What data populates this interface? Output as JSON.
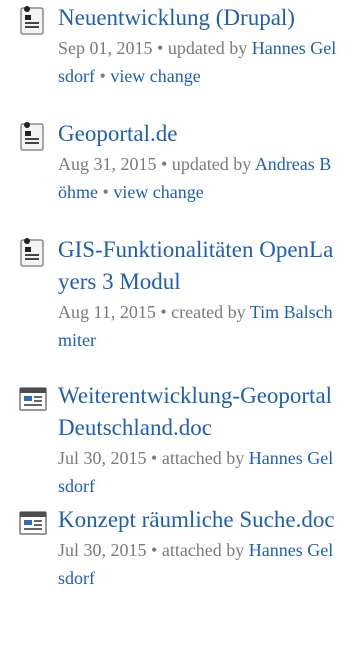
{
  "activity": {
    "items": [
      {
        "icon": "page-icon",
        "title": "Neuentwicklung (Drupal)",
        "date": "Sep 01, 2015",
        "action": "updated by",
        "author": "Hannes Gelsdorf",
        "extra_link": "view change"
      },
      {
        "icon": "page-icon",
        "title": "Geoportal.de",
        "date": "Aug 31, 2015",
        "action": "updated by",
        "author": "Andreas Böhme",
        "extra_link": "view change"
      },
      {
        "icon": "page-icon",
        "title": "GIS-Funktionalitäten OpenLayers 3 Modul",
        "date": "Aug 11, 2015",
        "action": "created by",
        "author": "Tim Balschmiter"
      },
      {
        "icon": "document-attachment-icon",
        "title": "Weiterentwicklung-Geoportal Deutschland.doc",
        "date": "Jul 30, 2015",
        "action": "attached by",
        "author": "Hannes Gelsdorf"
      },
      {
        "icon": "document-attachment-icon",
        "title": "Konzept räumliche Suche.doc",
        "date": "Jul 30, 2015",
        "action": "attached by",
        "author": "Hannes Gelsdorf"
      }
    ],
    "bullet": "•"
  },
  "colors": {
    "link": "#1f5fb2",
    "meta_text": "#7a7a7a"
  }
}
